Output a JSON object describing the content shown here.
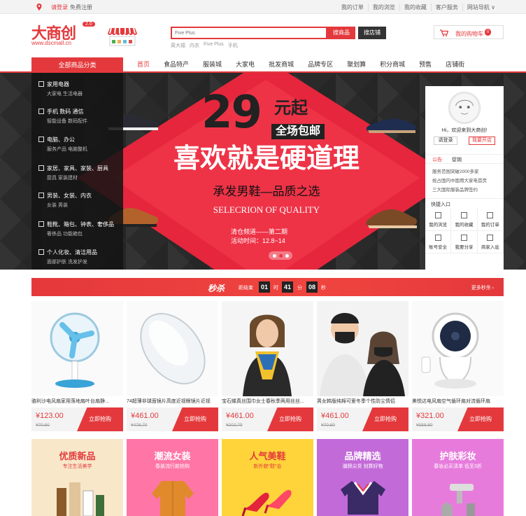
{
  "topbar": {
    "login": "请登录",
    "register": "免费注册",
    "links": [
      "我的订单",
      "我的浏览",
      "我的收藏",
      "客户服务",
      "网站导航 ∨"
    ]
  },
  "header": {
    "logo_text": "大商创",
    "logo_version": "2.0",
    "logo_url": "www.dscmall.cn",
    "search_placeholder": "Five Plus",
    "search_button": "搜商品",
    "shop_button": "搜店铺",
    "hotwords": [
      "周大福",
      "内衣",
      "Five Plus",
      "手机"
    ],
    "cart_label": "我的购物车",
    "cart_count": "0"
  },
  "nav": {
    "category_label": "全部商品分类",
    "items": [
      "首页",
      "食品特产",
      "服装城",
      "大家电",
      "批发商城",
      "品牌专区",
      "聚划算",
      "积分商城",
      "预售",
      "店铺街"
    ]
  },
  "categories": [
    {
      "title": "家用电器",
      "sub": "大家电  生活电器"
    },
    {
      "title": "手机  数码  通信",
      "sub": "智能设备  数码配件"
    },
    {
      "title": "电脑、办公",
      "sub": "服务产品  电脑整机"
    },
    {
      "title": "家居、家具、家装、厨具",
      "sub": "厨具  家装建材"
    },
    {
      "title": "男装、女装、内衣",
      "sub": "女装  男装"
    },
    {
      "title": "鞋靴、箱包、钟表、奢侈品",
      "sub": "奢侈品  功能箱包"
    },
    {
      "title": "个人化妆、清洁用品",
      "sub": "面部护肤  洗发护发"
    }
  ],
  "banner": {
    "price": "29",
    "price_suffix": "元起",
    "free_ship": "全场包邮",
    "headline": "喜欢就是硬道理",
    "subline": "承发男鞋—品质之选",
    "english": "SELECRION OF QUALITY",
    "event1": "清仓频道——第二期",
    "event2": "活动时间：12.8~14"
  },
  "user_panel": {
    "welcome": "Hi，欢迎来到大商创!",
    "login": "请登录",
    "open_shop": "我要开店",
    "tab_notice": "公告",
    "tab_promo": "促销",
    "news": [
      "服务范围突破2000多家",
      "抢占国内中国用大家电首页",
      "三大国际服装品牌签约"
    ],
    "quick_title": "快捷入口",
    "quick": [
      "我的浏览",
      "我的收藏",
      "我的订单",
      "账号安全",
      "我要分享",
      "商家入驻"
    ]
  },
  "seckill": {
    "title": "秒杀",
    "countdown_label": "距结束",
    "hours": "01",
    "hours_unit": "时",
    "minutes": "41",
    "minutes_unit": "分",
    "seconds": "08",
    "seconds_unit": "秒",
    "more": "更多秒杀"
  },
  "products": [
    {
      "name": "骆利沙电风扇家用落地扇叶台扇静...",
      "price": "¥123.00",
      "old": "¥70.80",
      "buy": "立即抢购"
    },
    {
      "name": "74超薄非球面镜片高度近视眼镜片近视",
      "price": "¥461.00",
      "old": "¥478.70",
      "buy": "立即抢购"
    },
    {
      "name": "宝石蝶真丝围巾女士春秋季两用丝丝...",
      "price": "¥461.00",
      "old": "¥202.79",
      "buy": "立即抢购"
    },
    {
      "name": "男女韩版纯棉可爱冬季个性防尘情侣",
      "price": "¥461.00",
      "old": "¥70.80",
      "buy": "立即抢购"
    },
    {
      "name": "美悦达电风扇空气循环扇对流循环扇",
      "price": "¥321.00",
      "old": "¥358.80",
      "buy": "立即抢购"
    }
  ],
  "promos": [
    {
      "title": "优质新品",
      "sub": "专注生活美学",
      "bg": "#f8e7c9",
      "color": "#e4393c"
    },
    {
      "title": "潮流女装",
      "sub": "春装流行款抢购",
      "bg": "#ff75a6",
      "color": "#fff"
    },
    {
      "title": "人气美鞋",
      "sub": "新外貌\"鞋\"会",
      "bg": "#ffd43a",
      "color": "#e4393c"
    },
    {
      "title": "品牌精选",
      "sub": "潮牌尖货 划算好物",
      "bg": "#c36ad9",
      "color": "#fff"
    },
    {
      "title": "护肤彩妆",
      "sub": "春妆必买清单 低至3折",
      "bg": "#e77bdc",
      "color": "#fff"
    }
  ],
  "colors": {
    "accent": "#e4393c",
    "dark": "#2a2a2a"
  }
}
